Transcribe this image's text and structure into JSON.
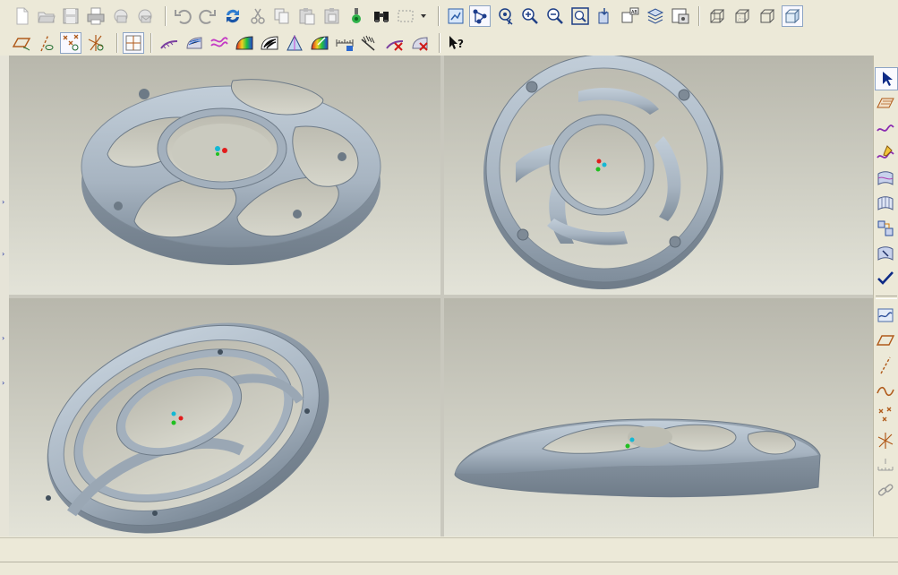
{
  "app": {
    "message_line": "",
    "colors": {
      "ui_background": "#ece9d8",
      "model_color": "#a8b6c4",
      "viewport_top": "#b8b7ac",
      "viewport_bottom": "#e3e3d8"
    }
  },
  "toolbar_top": {
    "buttons": [
      {
        "icon": "new-file-icon"
      },
      {
        "icon": "open-folder-icon"
      },
      {
        "icon": "save-icon"
      },
      {
        "icon": "print-icon"
      },
      {
        "icon": "send-mail-icon"
      },
      {
        "icon": "mail-icon"
      },
      {
        "icon": "undo-icon"
      },
      {
        "icon": "redo-icon"
      },
      {
        "icon": "regenerate-icon"
      },
      {
        "icon": "cut-icon"
      },
      {
        "icon": "copy-icon"
      },
      {
        "icon": "paste-icon"
      },
      {
        "icon": "paste-special-icon"
      },
      {
        "icon": "regenerate-manager-icon"
      },
      {
        "icon": "find-binoculars-icon"
      },
      {
        "icon": "selection-box-icon"
      },
      {
        "icon": "view-orient-icon"
      },
      {
        "icon": "model-tree-icon"
      },
      {
        "icon": "spin-center-icon"
      },
      {
        "icon": "zoom-in-icon"
      },
      {
        "icon": "zoom-out-icon"
      },
      {
        "icon": "refit-icon"
      },
      {
        "icon": "reorient-icon"
      },
      {
        "icon": "saved-views-icon"
      },
      {
        "icon": "layers-icon"
      },
      {
        "icon": "view-manager-icon"
      },
      {
        "icon": "wireframe-icon"
      },
      {
        "icon": "hidden-line-icon"
      },
      {
        "icon": "no-hidden-icon"
      },
      {
        "icon": "shading-icon"
      }
    ]
  },
  "toolbar_second": {
    "buttons": [
      {
        "icon": "datum-planes-icon"
      },
      {
        "icon": "datum-axes-icon"
      },
      {
        "icon": "datum-points-icon"
      },
      {
        "icon": "coordinate-systems-icon"
      },
      {
        "icon": "grid-snap-icon"
      },
      {
        "icon": "curve-analysis-icon"
      },
      {
        "icon": "section-analysis-icon"
      },
      {
        "icon": "offset-analysis-icon"
      },
      {
        "icon": "shade-analysis-icon"
      },
      {
        "icon": "reflection-analysis-icon"
      },
      {
        "icon": "slope-analysis-icon"
      },
      {
        "icon": "draft-analysis-icon"
      },
      {
        "icon": "dimension-icon"
      },
      {
        "icon": "measure-icon"
      },
      {
        "icon": "delete-analysis-icon"
      },
      {
        "icon": "hide-analysis-icon"
      },
      {
        "icon": "context-help-icon"
      }
    ]
  },
  "right_toolbar": {
    "buttons": [
      {
        "icon": "select-arrow-icon"
      },
      {
        "icon": "sketch-plane-icon"
      },
      {
        "icon": "curve-icon"
      },
      {
        "icon": "curve-edit-icon"
      },
      {
        "icon": "surface-icon"
      },
      {
        "icon": "surface-from-curves-icon"
      },
      {
        "icon": "connect-surface-icon"
      },
      {
        "icon": "trim-surface-icon"
      },
      {
        "icon": "done-check-icon"
      },
      {
        "icon": "offset-curve-icon"
      },
      {
        "icon": "datum-plane-icon"
      },
      {
        "icon": "datum-axis-icon"
      },
      {
        "icon": "spline-icon"
      },
      {
        "icon": "datum-point-icon"
      },
      {
        "icon": "coordinate-system-icon"
      },
      {
        "icon": "analysis-feature-icon"
      },
      {
        "icon": "chain-link-icon"
      }
    ]
  }
}
